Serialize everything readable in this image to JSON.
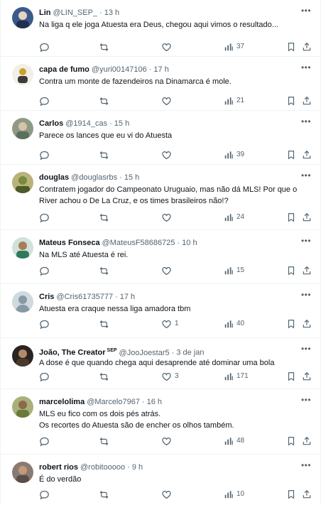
{
  "tweets": [
    {
      "name": "Lin",
      "handle": "@LIN_SEP_",
      "time": "13 h",
      "text": [
        "Na liga q ele joga Atuesta era Deus, chegou aqui vimos o resultado..."
      ],
      "likes": "",
      "views": "37",
      "avatar_color": "#3a5a8c"
    },
    {
      "name": "capa de fumo",
      "handle": "@yuri00147106",
      "time": "17 h",
      "text": [
        "Contra um monte de fazendeiros na Dinamarca é mole."
      ],
      "likes": "",
      "views": "21",
      "avatar_color": "#c9a227"
    },
    {
      "name": "Carlos",
      "handle": "@1914_cas",
      "time": "15 h",
      "text": [
        "Parece os lances que eu vi do Atuesta"
      ],
      "likes": "",
      "views": "39",
      "avatar_color": "#5b6f5a"
    },
    {
      "name": "douglas",
      "handle": "@douglasrbs",
      "time": "15 h",
      "text": [
        "Contratem jogador do Campeonato Uruguaio, mas não dá MLS! Por que o",
        "River achou o De La Cruz, e os times brasileiros não!?"
      ],
      "likes": "",
      "views": "24",
      "avatar_color": "#7a8a3c"
    },
    {
      "name": "Mateus Fonseca",
      "handle": "@MateusF58686725",
      "time": "10 h",
      "text": [
        "Na MLS até Atuesta é rei."
      ],
      "likes": "",
      "views": "15",
      "avatar_color": "#2f7a5a"
    },
    {
      "name": "Cris",
      "handle": "@Cris61735777",
      "time": "17 h",
      "text": [
        "Atuesta era craque nessa liga amadora tbm"
      ],
      "likes": "1",
      "views": "40",
      "avatar_color": "#b8c2cc"
    },
    {
      "name": "João, The Creator",
      "badge": "SEP",
      "handle": "@JooJoestar5",
      "time": "3 de jan",
      "text": [
        "A dose é que quando chega aqui desaprende até dominar uma bola"
      ],
      "likes": "3",
      "views": "171",
      "avatar_color": "#4a3a2e"
    },
    {
      "name": "marcelolima",
      "handle": "@Marcelo7967",
      "time": "16 h",
      "text": [
        "MLS eu fico com os dois pés atrás.",
        "Os recortes do Atuesta são de encher os olhos também."
      ],
      "likes": "",
      "views": "48",
      "avatar_color": "#6b7a3a"
    },
    {
      "name": "robert rios",
      "handle": "@robitooooo",
      "time": "9 h",
      "text": [
        "É do verdão"
      ],
      "likes": "",
      "views": "10",
      "avatar_color": "#5a4e48"
    }
  ],
  "icons": {
    "reply": "reply-icon",
    "retweet": "retweet-icon",
    "like": "heart-icon",
    "views": "views-icon",
    "bookmark": "bookmark-icon",
    "share": "share-icon",
    "more": "more-icon"
  },
  "colors": {
    "text_primary": "#0f1419",
    "text_secondary": "#536471",
    "divider": "#eff3f4"
  }
}
